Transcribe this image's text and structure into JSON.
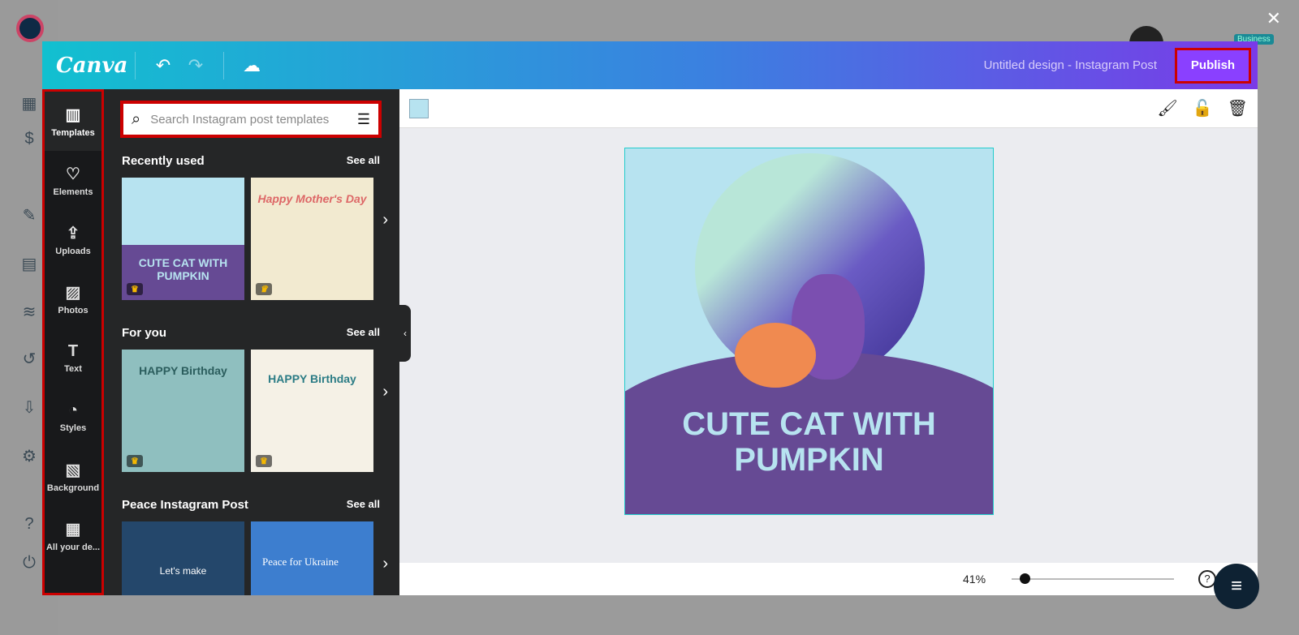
{
  "host": {
    "close": "✕",
    "badge": "Business"
  },
  "topbar": {
    "logo": "Canva",
    "undo": "↶",
    "redo": "↷",
    "save_icon": "☁",
    "title": "Untitled design - Instagram Post",
    "publish": "Publish"
  },
  "rail": [
    {
      "icon": "▥",
      "label": "Templates"
    },
    {
      "icon": "♡",
      "label": "Elements"
    },
    {
      "icon": "⇪",
      "label": "Uploads"
    },
    {
      "icon": "▨",
      "label": "Photos"
    },
    {
      "icon": "T",
      "label": "Text"
    },
    {
      "icon": "◔",
      "label": "Styles"
    },
    {
      "icon": "▧",
      "label": "Background"
    },
    {
      "icon": "▦",
      "label": "All your de..."
    }
  ],
  "search": {
    "placeholder": "Search Instagram post templates"
  },
  "sections": [
    {
      "title": "Recently used",
      "see_all": "See all",
      "items": [
        "CUTE CAT WITH PUMPKIN",
        "Happy Mother's Day"
      ]
    },
    {
      "title": "For you",
      "see_all": "See all",
      "items": [
        "HAPPY Birthday",
        "HAPPY Birthday"
      ]
    },
    {
      "title": "Peace Instagram Post",
      "see_all": "See all",
      "items": [
        "Let's make",
        "Peace for Ukraine"
      ]
    }
  ],
  "design": {
    "text": "CUTE CAT WITH PUMPKIN",
    "bg_color": "#b7e3f0"
  },
  "footer": {
    "zoom": "41%",
    "zoom_fraction": 0.05,
    "help": "?"
  },
  "fab": "≡"
}
